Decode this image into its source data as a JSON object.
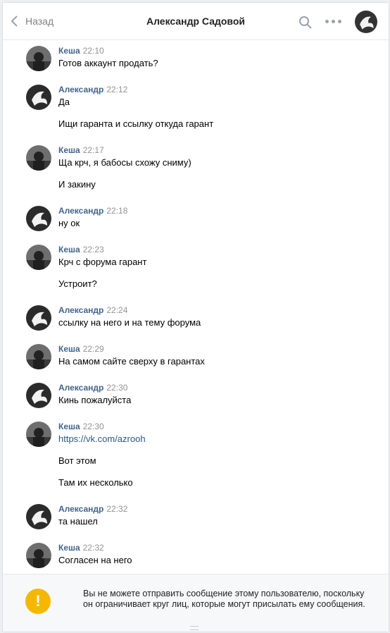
{
  "header": {
    "back_label": "Назад",
    "title": "Александр Садовой"
  },
  "icons": {
    "back": "chevron-left-icon",
    "search": "search-icon",
    "more": "more-dots-icon",
    "warning": "exclamation-icon"
  },
  "colors": {
    "author": "#42648b",
    "time": "#939393",
    "link": "#2a5885",
    "warning": "#f5b800",
    "background": "#edeef0"
  },
  "messages": [
    {
      "author": "Кеша",
      "time": "22:10",
      "lines": [
        "Готов аккаунт продать?"
      ]
    },
    {
      "author": "Александр",
      "time": "22:12",
      "lines": [
        "Да",
        "Ищи гаранта и ссылку откуда гарант"
      ]
    },
    {
      "author": "Кеша",
      "time": "22:17",
      "lines": [
        "Ща крч, я бабосы схожу сниму)",
        "И закину"
      ]
    },
    {
      "author": "Александр",
      "time": "22:18",
      "lines": [
        "ну ок"
      ]
    },
    {
      "author": "Кеша",
      "time": "22:23",
      "lines": [
        "Крч с форума гарант",
        "Устроит?"
      ]
    },
    {
      "author": "Александр",
      "time": "22:24",
      "lines": [
        "ссылку на него и на тему форума"
      ]
    },
    {
      "author": "Кеша",
      "time": "22:29",
      "lines": [
        "На самом сайте сверху в гарантах"
      ]
    },
    {
      "author": "Александр",
      "time": "22:30",
      "lines": [
        "Кинь пожалуйста"
      ]
    },
    {
      "author": "Кеша",
      "time": "22:30",
      "lines": [
        "https://vk.com/azrooh",
        "Вот этом",
        "Там их несколько"
      ]
    },
    {
      "author": "Александр",
      "time": "22:32",
      "lines": [
        "та нашел"
      ]
    },
    {
      "author": "Кеша",
      "time": "22:32",
      "lines": [
        "Согласен на него"
      ]
    }
  ],
  "notice": {
    "text": "Вы не можете отправить сообщение этому пользователю, поскольку он ограничивает круг лиц, которые могут присылать ему сообщения."
  }
}
